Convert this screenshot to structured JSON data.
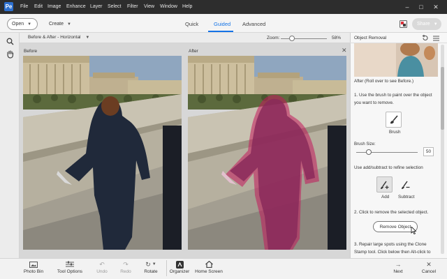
{
  "app": {
    "logo": "Pe"
  },
  "menu": [
    "File",
    "Edit",
    "Image",
    "Enhance",
    "Layer",
    "Select",
    "Filter",
    "View",
    "Window",
    "Help"
  ],
  "toolbar": {
    "open_label": "Open",
    "create_label": "Create",
    "tabs": [
      "Quick",
      "Guided",
      "Advanced"
    ],
    "active_tab": "Guided",
    "share_label": "Share"
  },
  "viewbar": {
    "view_mode": "Before & After - Horizontal",
    "zoom_label": "Zoom:",
    "zoom_value": "58%",
    "zoom_level": 0.58
  },
  "canvas": {
    "before_label": "Before",
    "after_label": "After"
  },
  "panel": {
    "title": "Object Removal",
    "after_caption": "After (Roll over to see Before.)",
    "step1": "1. Use the brush to paint over the object you want to remove.",
    "brush_label": "Brush",
    "brush_size_label": "Brush Size:",
    "brush_size_value": "50",
    "add_subtract_text": "Use add/subtract to refine selection",
    "add_label": "Add",
    "subtract_label": "Subtract",
    "step2": "2. Click to remove the selected object.",
    "remove_button": "Remove Object",
    "step3": "3. Repair large spots using the Clone Stamp tool. Click below then Alt-click to"
  },
  "bottombar": {
    "photo_bin": "Photo Bin",
    "tool_options": "Tool Options",
    "undo": "Undo",
    "redo": "Redo",
    "rotate": "Rotate",
    "organizer": "Organizer",
    "home_screen": "Home Screen",
    "next": "Next",
    "cancel": "Cancel"
  },
  "colors": {
    "accent": "#1473e6",
    "menubar": "#2d2d2d",
    "selection_overlay": "#c2185b"
  }
}
